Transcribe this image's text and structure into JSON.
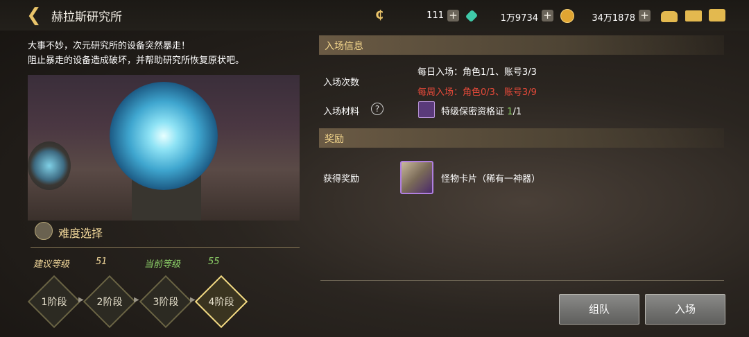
{
  "header": {
    "title": "赫拉斯研究所"
  },
  "currencies": [
    {
      "name": "cera",
      "value": "111"
    },
    {
      "name": "gem",
      "value": "1万9734"
    },
    {
      "name": "gold",
      "value": "34万1878"
    }
  ],
  "description": {
    "line1": "大事不妙，次元研究所的设备突然暴走！",
    "line2": "阻止暴走的设备造成破坏，并帮助研究所恢复原状吧。"
  },
  "difficulty": {
    "title": "难度选择",
    "recommended_label": "建议等级",
    "recommended_value": "51",
    "current_label": "当前等级",
    "current_value": "55",
    "stages": [
      "1阶段",
      "2阶段",
      "3阶段",
      "4阶段"
    ],
    "selected_stage": "4阶段"
  },
  "entry_info": {
    "title": "入场信息",
    "count_label": "入场次数",
    "daily": "每日入场：角色1/1、账号3/3",
    "weekly": "每周入场：角色0/3、账号3/9",
    "material_label": "入场材料",
    "material_name": "特级保密资格证",
    "material_have": "1",
    "material_need": "/1"
  },
  "rewards": {
    "title": "奖励",
    "label": "获得奖励",
    "item": "怪物卡片（稀有一神器）"
  },
  "buttons": {
    "party": "组队",
    "enter": "入场"
  },
  "colors": {
    "accent": "#f3d68c",
    "weekly": "#e84a3a",
    "current_level": "#8fd46a",
    "recommended_level": "#f1d79a"
  }
}
